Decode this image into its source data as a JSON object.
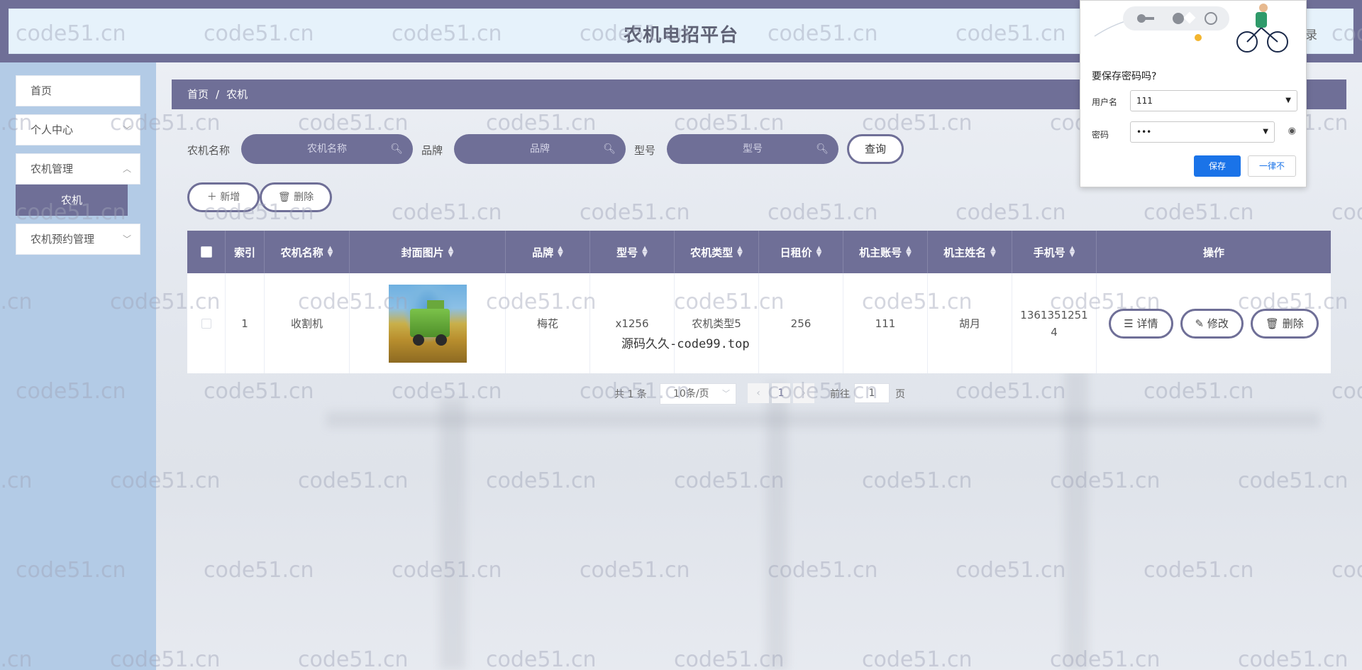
{
  "header": {
    "title": "农机电招平台",
    "login_label": "登录"
  },
  "sidebar": {
    "items": [
      {
        "label": "首页"
      },
      {
        "label": "个人中心"
      },
      {
        "label": "农机管理"
      },
      {
        "label": "农机预约管理"
      }
    ],
    "active_sub": "农机"
  },
  "breadcrumb": {
    "home": "首页",
    "sep": "/",
    "current": "农机"
  },
  "search": {
    "name_label": "农机名称",
    "name_placeholder": "农机名称",
    "brand_label": "品牌",
    "brand_placeholder": "品牌",
    "model_label": "型号",
    "model_placeholder": "型号",
    "query_label": "查询"
  },
  "actions": {
    "add_label": "新增",
    "delete_label": "删除"
  },
  "table": {
    "headers": [
      "索引",
      "农机名称",
      "封面图片",
      "品牌",
      "型号",
      "农机类型",
      "日租价",
      "机主账号",
      "机主姓名",
      "手机号",
      "操作"
    ],
    "rows": [
      {
        "index": "1",
        "name": "收割机",
        "brand": "梅花",
        "model": "x1256",
        "type": "农机类型5",
        "price": "256",
        "owner_account": "111",
        "owner_name": "胡月",
        "phone_line1": "1361351251",
        "phone_line2": "4"
      }
    ],
    "row_actions": {
      "detail": "详情",
      "edit": "修改",
      "delete": "删除"
    }
  },
  "pagination": {
    "total": "共 1 条",
    "page_size": "10条/页",
    "current_page": "1",
    "goto_label": "前往",
    "goto_value": "1",
    "page_suffix": "页"
  },
  "overlay_text": "源码久久-code99.top",
  "watermark": "code51.cn",
  "password_popup": {
    "title": "要保存密码吗?",
    "username_label": "用户名",
    "username_value": "111",
    "password_label": "密码",
    "password_value": "•••",
    "save_label": "保存",
    "never_label": "一律不"
  },
  "colors": {
    "accent": "#6f6f97",
    "sidebar_bg": "#b3cbe6",
    "header_inner": "#e6f2fb",
    "save_blue": "#1a73e8"
  }
}
